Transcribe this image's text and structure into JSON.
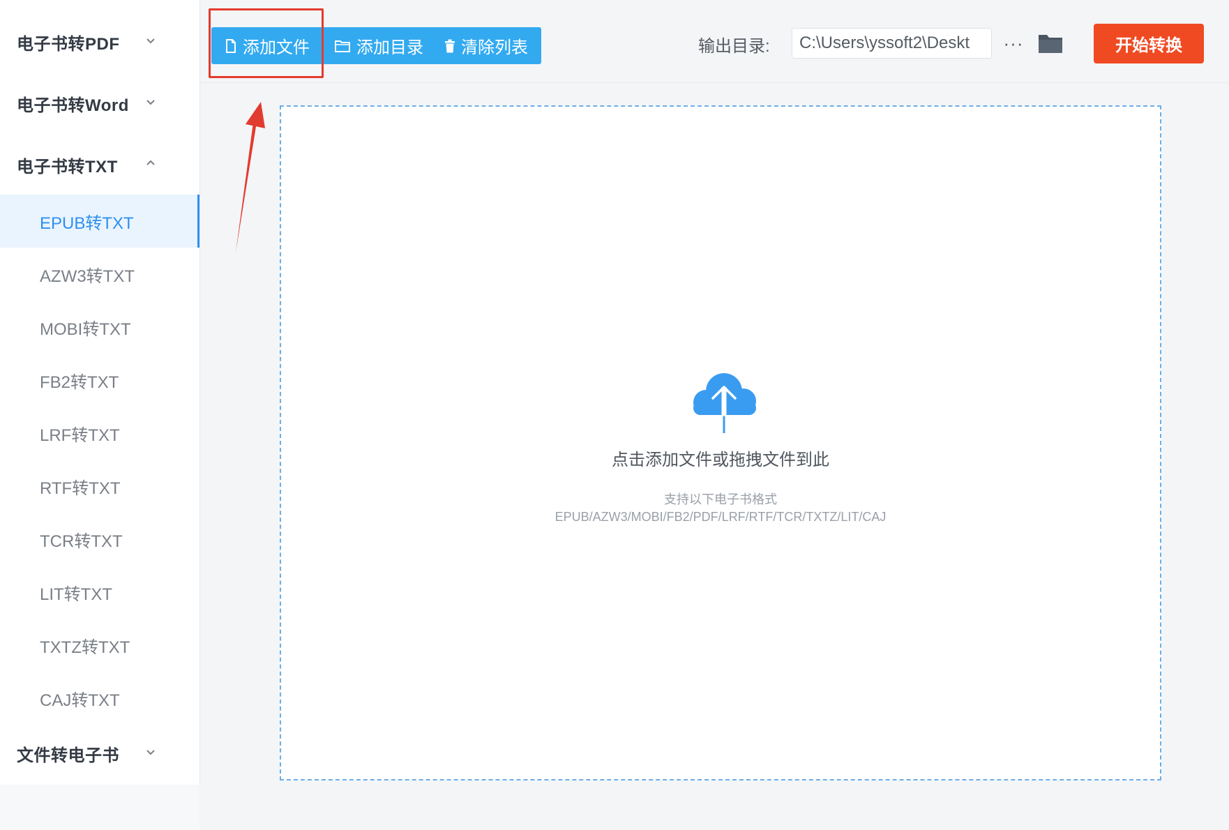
{
  "sidebar": {
    "groups": [
      {
        "label": "电子书转PDF",
        "expanded": false
      },
      {
        "label": "电子书转Word",
        "expanded": false
      },
      {
        "label": "电子书转TXT",
        "expanded": true
      },
      {
        "label": "文件转电子书",
        "expanded": false
      }
    ],
    "txt_items": [
      {
        "label": "EPUB转TXT",
        "active": true
      },
      {
        "label": "AZW3转TXT",
        "active": false
      },
      {
        "label": "MOBI转TXT",
        "active": false
      },
      {
        "label": "FB2转TXT",
        "active": false
      },
      {
        "label": "LRF转TXT",
        "active": false
      },
      {
        "label": "RTF转TXT",
        "active": false
      },
      {
        "label": "TCR转TXT",
        "active": false
      },
      {
        "label": "LIT转TXT",
        "active": false
      },
      {
        "label": "TXTZ转TXT",
        "active": false
      },
      {
        "label": "CAJ转TXT",
        "active": false
      }
    ]
  },
  "toolbar": {
    "add_file_label": "添加文件",
    "add_dir_label": "添加目录",
    "clear_list_label": "清除列表",
    "output_dir_label": "输出目录:",
    "output_dir_value": "C:\\Users\\yssoft2\\Deskt",
    "more_label": "···",
    "start_label": "开始转换"
  },
  "dropzone": {
    "hint": "点击添加文件或拖拽文件到此",
    "support_title": "支持以下电子书格式",
    "support_formats": "EPUB/AZW3/MOBI/FB2/PDF/LRF/RTF/TCR/TXTZ/LIT/CAJ"
  },
  "colors": {
    "accent_blue": "#33aaf0",
    "active_blue": "#2f8ff0",
    "start_orange": "#f04a23",
    "annotation_red": "#e23b2f"
  },
  "icons": {
    "add_file": "file-icon",
    "add_dir": "folder-outline-icon",
    "clear": "trash-icon",
    "output_folder": "folder-icon",
    "upload": "cloud-upload-icon",
    "group_collapsed": "chevron-down-icon",
    "group_expanded": "chevron-up-icon"
  }
}
